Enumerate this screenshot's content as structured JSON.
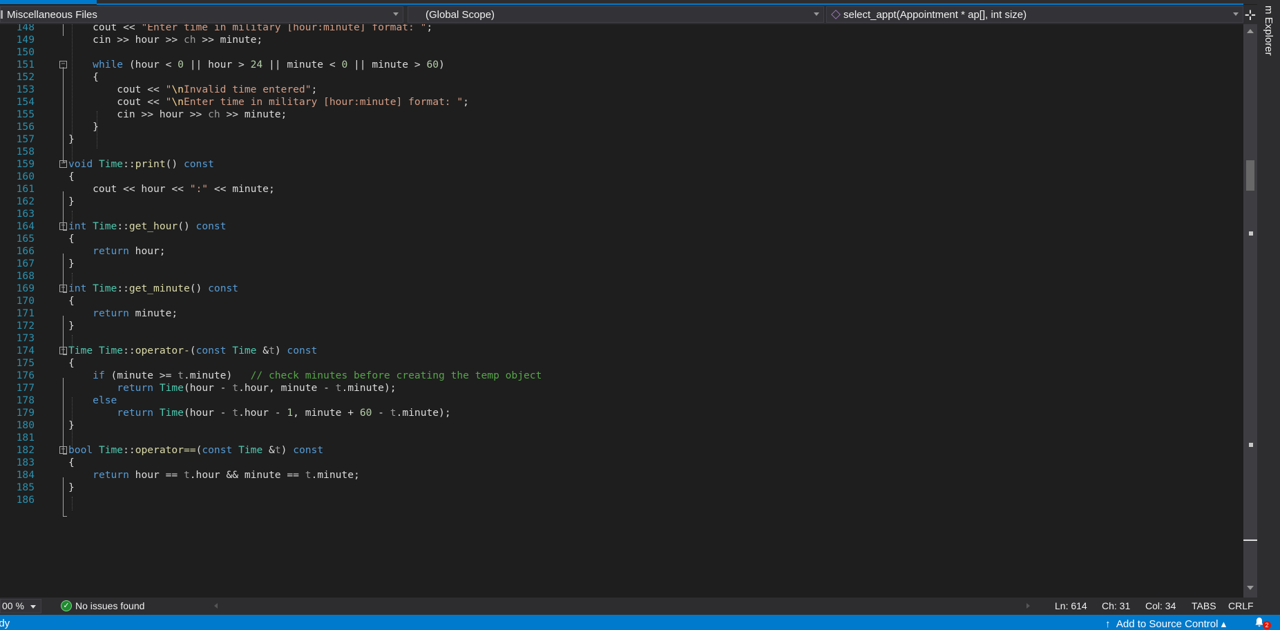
{
  "navbar": {
    "project": "Miscellaneous Files",
    "scope": "(Global Scope)",
    "member": "select_appt(Appointment * ap[], int size)"
  },
  "right_panel": {
    "title": "m Explorer"
  },
  "code_lines": [
    {
      "n": "148",
      "html": "    cout &lt;&lt; <span class=\"st\">\"Enter time in military [hour:minute] format: \"</span>;"
    },
    {
      "n": "149",
      "html": "    cin &gt;&gt; hour &gt;&gt; <span class=\"pm\">ch</span> &gt;&gt; minute;"
    },
    {
      "n": "150",
      "html": ""
    },
    {
      "n": "151",
      "html": "    <span class=\"kw\">while</span> (hour &lt; <span class=\"nu\">0</span> || hour &gt; <span class=\"nu\">24</span> || minute &lt; <span class=\"nu\">0</span> || minute &gt; <span class=\"nu\">60</span>)"
    },
    {
      "n": "152",
      "html": "    {"
    },
    {
      "n": "153",
      "html": "        cout &lt;&lt; <span class=\"st\">\"<span class=\"es\">\\n</span>Invalid time entered\"</span>;"
    },
    {
      "n": "154",
      "html": "        cout &lt;&lt; <span class=\"st\">\"<span class=\"es\">\\n</span>Enter time in military [hour:minute] format: \"</span>;"
    },
    {
      "n": "155",
      "html": "        cin &gt;&gt; hour &gt;&gt; <span class=\"pm\">ch</span> &gt;&gt; minute;"
    },
    {
      "n": "156",
      "html": "    }"
    },
    {
      "n": "157",
      "html": "}"
    },
    {
      "n": "158",
      "html": ""
    },
    {
      "n": "159",
      "html": "<span class=\"kw\">void</span> <span class=\"ty\">Time</span>::<span class=\"fn\">print</span>() <span class=\"kw\">const</span>"
    },
    {
      "n": "160",
      "html": "{"
    },
    {
      "n": "161",
      "html": "    cout &lt;&lt; hour &lt;&lt; <span class=\"st\">\":\"</span> &lt;&lt; minute;"
    },
    {
      "n": "162",
      "html": "}"
    },
    {
      "n": "163",
      "html": ""
    },
    {
      "n": "164",
      "html": "<span class=\"kw\">int</span> <span class=\"ty\">Time</span>::<span class=\"fn\">get_hour</span>() <span class=\"kw\">const</span>"
    },
    {
      "n": "165",
      "html": "{"
    },
    {
      "n": "166",
      "html": "    <span class=\"kw\">return</span> hour;"
    },
    {
      "n": "167",
      "html": "}"
    },
    {
      "n": "168",
      "html": ""
    },
    {
      "n": "169",
      "html": "<span class=\"kw\">int</span> <span class=\"ty\">Time</span>::<span class=\"fn\">get_minute</span>() <span class=\"kw\">const</span>"
    },
    {
      "n": "170",
      "html": "{"
    },
    {
      "n": "171",
      "html": "    <span class=\"kw\">return</span> minute;"
    },
    {
      "n": "172",
      "html": "}"
    },
    {
      "n": "173",
      "html": ""
    },
    {
      "n": "174",
      "html": "<span class=\"ty\">Time</span> <span class=\"ty\">Time</span>::<span class=\"fn\">operator-</span>(<span class=\"kw\">const</span> <span class=\"ty\">Time</span> &amp;<span class=\"pm\">t</span>) <span class=\"kw\">const</span>"
    },
    {
      "n": "175",
      "html": "{"
    },
    {
      "n": "176",
      "html": "    <span class=\"kw\">if</span> (minute &gt;= <span class=\"pm\">t</span>.minute)   <span class=\"cm\">// check minutes before creating the temp object</span>"
    },
    {
      "n": "177",
      "html": "        <span class=\"kw\">return</span> <span class=\"ty\">Time</span>(hour - <span class=\"pm\">t</span>.hour, minute - <span class=\"pm\">t</span>.minute);"
    },
    {
      "n": "178",
      "html": "    <span class=\"kw\">else</span>"
    },
    {
      "n": "179",
      "html": "        <span class=\"kw\">return</span> <span class=\"ty\">Time</span>(hour - <span class=\"pm\">t</span>.hour - <span class=\"nu\">1</span>, minute + <span class=\"nu\">60</span> - <span class=\"pm\">t</span>.minute);"
    },
    {
      "n": "180",
      "html": "}"
    },
    {
      "n": "181",
      "html": ""
    },
    {
      "n": "182",
      "html": "<span class=\"kw\">bool</span> <span class=\"ty\">Time</span>::<span class=\"fn\">operator==</span>(<span class=\"kw\">const</span> <span class=\"ty\">Time</span> &amp;<span class=\"pm\">t</span>) <span class=\"kw\">const</span>"
    },
    {
      "n": "183",
      "html": "{"
    },
    {
      "n": "184",
      "html": "    <span class=\"kw\">return</span> hour == <span class=\"pm\">t</span>.hour &amp;&amp; minute == <span class=\"pm\">t</span>.minute;"
    },
    {
      "n": "185",
      "html": "}"
    },
    {
      "n": "186",
      "html": ""
    }
  ],
  "editor_bar": {
    "zoom": "00 %",
    "issues": "No issues found",
    "ln": "Ln: 614",
    "ch": "Ch: 31",
    "col": "Col: 34",
    "tabs": "TABS",
    "eol": "CRLF"
  },
  "status_bar": {
    "ready": "ady",
    "source_control": "Add to Source Control",
    "notification_count": "2"
  }
}
